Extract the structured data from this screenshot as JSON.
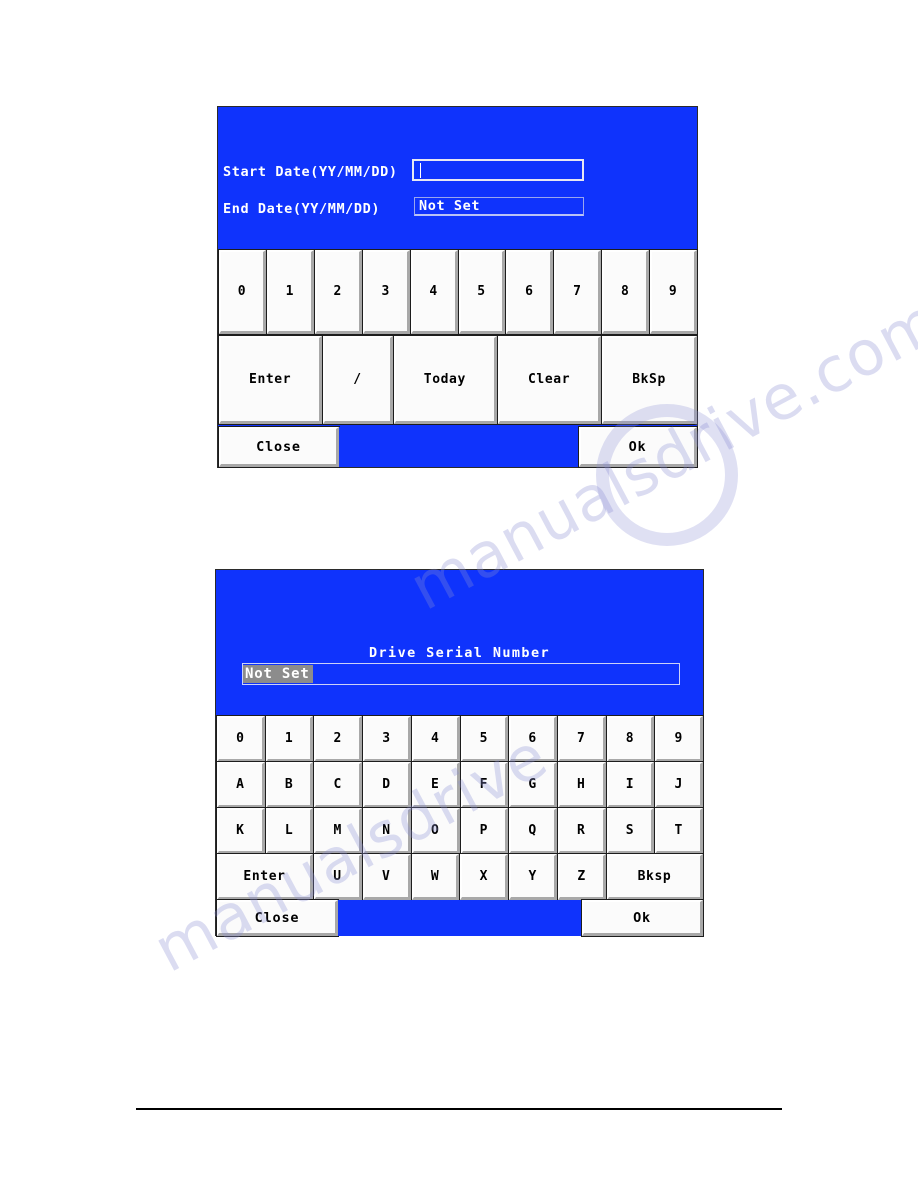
{
  "page": {
    "background_color": "#ffffff",
    "watermark": {
      "line1": "manualsdrive.com",
      "line2": "manualsdrive",
      "color": "#8b8fd4"
    },
    "footer_rule": true
  },
  "colors": {
    "screen_blue": "#0f33fc",
    "key_face": "#fbfbfb",
    "key_shadow": "#a8a8a8",
    "key_outline": "#1d1d1d",
    "selection_gray": "#8c8c8c",
    "text_white": "#ffffff",
    "text_black": "#000000"
  },
  "date_dialog": {
    "name": "date-range-entry",
    "fields": [
      {
        "label": "Start Date(YY/MM/DD)",
        "value": "",
        "state": "active",
        "caret": true
      },
      {
        "label": "End Date(YY/MM/DD)",
        "value": "Not Set",
        "state": "inactive",
        "caret": false
      }
    ],
    "keypad": {
      "digits": [
        "0",
        "1",
        "2",
        "3",
        "4",
        "5",
        "6",
        "7",
        "8",
        "9"
      ],
      "functions": [
        "Enter",
        "/",
        "Today",
        "Clear",
        "BkSp"
      ]
    },
    "actions": {
      "close_label": "Close",
      "ok_label": "Ok"
    }
  },
  "serial_dialog": {
    "name": "drive-serial-number-entry",
    "title": "Drive Serial Number",
    "field": {
      "value": "Not Set",
      "selected": true
    },
    "keypad": {
      "row_digits": [
        "0",
        "1",
        "2",
        "3",
        "4",
        "5",
        "6",
        "7",
        "8",
        "9"
      ],
      "row_alpha1": [
        "A",
        "B",
        "C",
        "D",
        "E",
        "F",
        "G",
        "H",
        "I",
        "J"
      ],
      "row_alpha2": [
        "K",
        "L",
        "M",
        "N",
        "O",
        "P",
        "Q",
        "R",
        "S",
        "T"
      ],
      "row_last": [
        "Enter",
        "U",
        "V",
        "W",
        "X",
        "Y",
        "Z",
        "Bksp"
      ]
    },
    "actions": {
      "close_label": "Close",
      "ok_label": "Ok"
    }
  }
}
